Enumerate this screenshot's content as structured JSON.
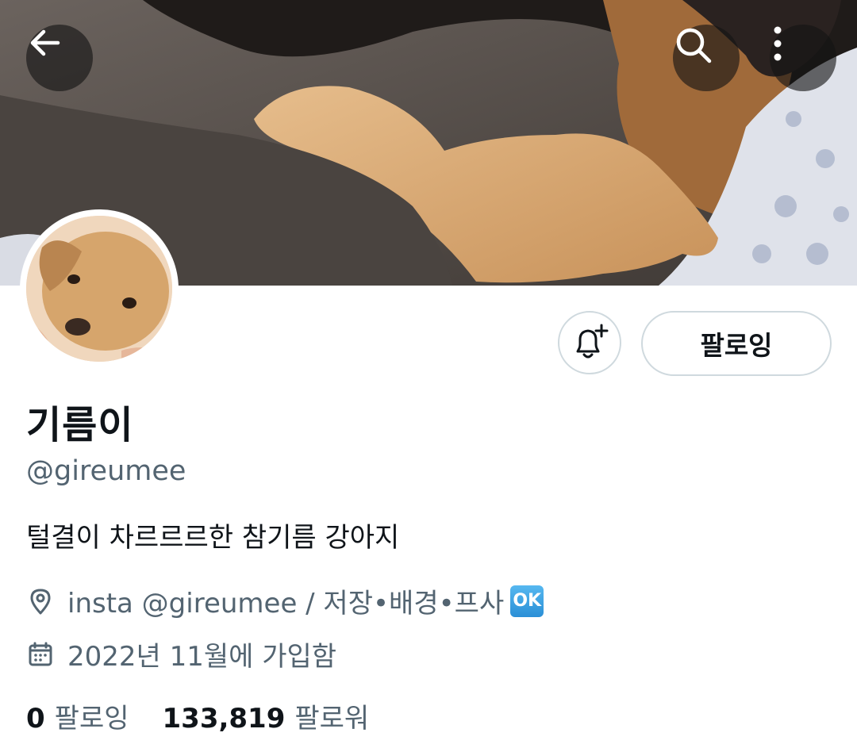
{
  "header": {
    "back_icon": "arrow-left-icon",
    "search_icon": "search-icon",
    "more_icon": "more-vertical-icon"
  },
  "profile": {
    "display_name": "기름이",
    "handle": "@gireumee",
    "bio": "털결이 차르르르한 참기름 강아지",
    "location_text": "insta @gireumee / 저장•배경•프사",
    "location_emoji": "OK",
    "joined": "2022년 11월에 가입함"
  },
  "actions": {
    "notify_icon": "bell-plus-icon",
    "follow_label": "팔로잉"
  },
  "stats": {
    "following_count": "0",
    "following_label": "팔로잉",
    "followers_count": "133,819",
    "followers_label": "팔로워"
  },
  "colors": {
    "text_primary": "#0f1419",
    "text_secondary": "#536471",
    "border": "#cfd9de",
    "emoji_blue": "#2b8fd6"
  }
}
